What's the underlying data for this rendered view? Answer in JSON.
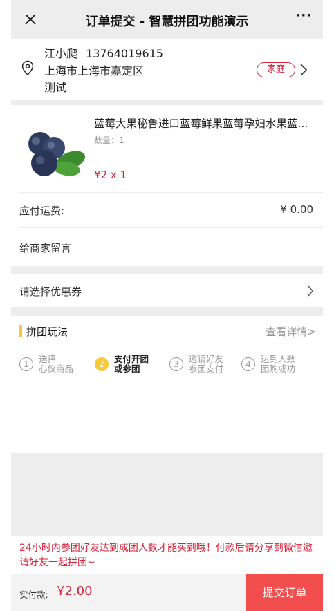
{
  "nav": {
    "title": "订单提交 - 智慧拼团功能演示",
    "more_label": "···",
    "close_icon": "close-icon"
  },
  "address": {
    "name": "江小爬",
    "phone": "13764019615",
    "line": "上海市上海市嘉定区",
    "detail": "测试",
    "tag": "家庭",
    "pin_icon": "location-pin-icon",
    "arrow_icon": "chevron-right-icon"
  },
  "product": {
    "title": "蓝莓大果秘鲁进口蓝莓鲜果蓝莓孕妇水果蓝...",
    "qty": "数量：1",
    "price": "¥2 x 1"
  },
  "shipping": {
    "label": "应付运费:",
    "value": "¥ 0.00"
  },
  "message": {
    "label": "给商家留言"
  },
  "coupon": {
    "label": "请选择优惠券",
    "arrow_icon": "chevron-right-icon"
  },
  "group": {
    "title": "拼团玩法",
    "detail_link": "查看详情>",
    "steps": [
      {
        "num": "1",
        "line1": "选择",
        "line2": "心仪商品",
        "active": false
      },
      {
        "num": "2",
        "line1": "支付开团",
        "line2": "或参团",
        "active": true
      },
      {
        "num": "3",
        "line1": "邀请好友",
        "line2": "参团支付",
        "active": false
      },
      {
        "num": "4",
        "line1": "达到人数",
        "line2": "团购成功",
        "active": false
      }
    ]
  },
  "notice": "24小时内参团好友达到成团人数才能买到哦！付款后请分享到微信邀请好友一起拼团~",
  "footer": {
    "pay_label": "实付款:",
    "pay_amount": "¥2.00",
    "submit_label": "提交订单"
  },
  "colors": {
    "accent_red": "#d6223b",
    "submit_red": "#f24e4e",
    "step_yellow": "#f7c83a",
    "divider_grey": "#ededed"
  }
}
